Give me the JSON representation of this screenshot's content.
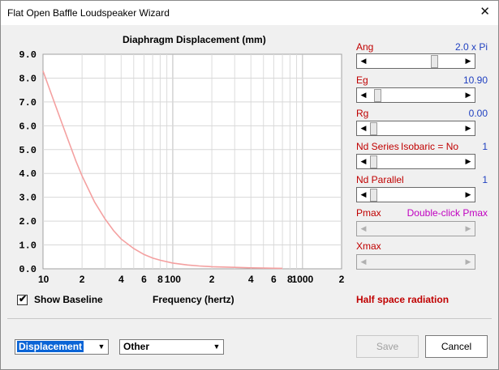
{
  "window": {
    "title": "Flat Open Baffle Loudspeaker Wizard",
    "close_glyph": "✕"
  },
  "chart": {
    "title": "Diaphragm Displacement (mm)",
    "xlabel": "Frequency (hertz)"
  },
  "chart_data": {
    "type": "line",
    "title": "Diaphragm Displacement (mm)",
    "xlabel": "Frequency (hertz)",
    "ylabel": "",
    "x_scale": "log",
    "xlim": [
      10,
      2000
    ],
    "ylim": [
      0,
      9
    ],
    "y_ticks": [
      "0.0",
      "1.0",
      "2.0",
      "3.0",
      "4.0",
      "5.0",
      "6.0",
      "7.0",
      "8.0",
      "9.0"
    ],
    "x_ticks": [
      {
        "value": 10,
        "label": "10"
      },
      {
        "value": 20,
        "label": "2"
      },
      {
        "value": 40,
        "label": "4"
      },
      {
        "value": 60,
        "label": "6"
      },
      {
        "value": 80,
        "label": "8"
      },
      {
        "value": 100,
        "label": "100"
      },
      {
        "value": 200,
        "label": "2"
      },
      {
        "value": 400,
        "label": "4"
      },
      {
        "value": 600,
        "label": "6"
      },
      {
        "value": 800,
        "label": "8"
      },
      {
        "value": 1000,
        "label": "1000"
      },
      {
        "value": 2000,
        "label": "2"
      }
    ],
    "grid": true,
    "series": [
      {
        "color": "#f4a0a0",
        "x": [
          10,
          12,
          14,
          16,
          18,
          20,
          25,
          30,
          35,
          40,
          50,
          60,
          70,
          80,
          100,
          130,
          160,
          200,
          300,
          400,
          500,
          600,
          700
        ],
        "y": [
          8.3,
          7.1,
          6.1,
          5.25,
          4.5,
          3.9,
          2.8,
          2.1,
          1.6,
          1.25,
          0.85,
          0.6,
          0.45,
          0.36,
          0.24,
          0.16,
          0.12,
          0.09,
          0.06,
          0.04,
          0.03,
          0.025,
          0.02
        ]
      }
    ]
  },
  "options": {
    "show_baseline_label": "Show Baseline",
    "show_baseline_checked": true,
    "radiation_text": "Half space radiation"
  },
  "params": {
    "ang": {
      "label": "Ang",
      "value": "2.0 x Pi",
      "position": 0.72
    },
    "eg": {
      "label": "Eg",
      "value": "10.90",
      "position": 0.05
    },
    "rg": {
      "label": "Rg",
      "value": "0.00",
      "position": 0.0
    },
    "nd_series": {
      "label": "Nd Series",
      "extra": "Isobaric = No",
      "value": "1",
      "position": 0.0
    },
    "nd_parallel": {
      "label": "Nd  Parallel",
      "value": "1",
      "position": 0.0
    },
    "pmax": {
      "label": "Pmax",
      "value": "Double-click Pmax",
      "value_color": "#c000c0"
    },
    "xmax": {
      "label": "Xmax",
      "value": ""
    }
  },
  "footer": {
    "plot_select": "Displacement",
    "other_select": "Other",
    "save_label": "Save",
    "cancel_label": "Cancel"
  },
  "icons": {
    "check": "✔",
    "arrow_left": "◀",
    "arrow_right": "▶",
    "dropdown": "▼"
  }
}
